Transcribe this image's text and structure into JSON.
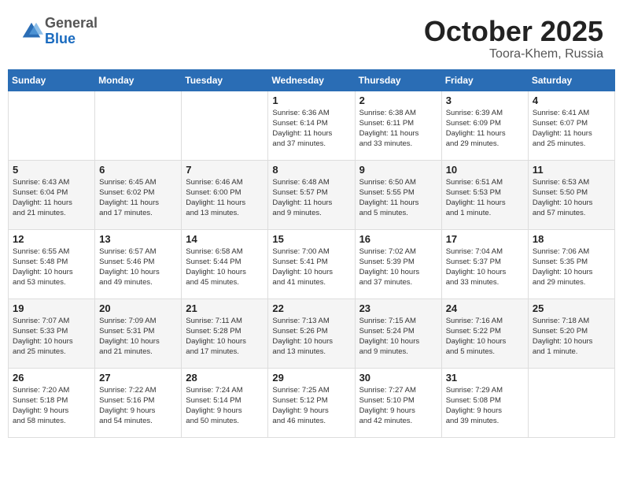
{
  "header": {
    "logo_general": "General",
    "logo_blue": "Blue",
    "month": "October 2025",
    "location": "Toora-Khem, Russia"
  },
  "days_of_week": [
    "Sunday",
    "Monday",
    "Tuesday",
    "Wednesday",
    "Thursday",
    "Friday",
    "Saturday"
  ],
  "weeks": [
    [
      {
        "day": "",
        "info": ""
      },
      {
        "day": "",
        "info": ""
      },
      {
        "day": "",
        "info": ""
      },
      {
        "day": "1",
        "info": "Sunrise: 6:36 AM\nSunset: 6:14 PM\nDaylight: 11 hours\nand 37 minutes."
      },
      {
        "day": "2",
        "info": "Sunrise: 6:38 AM\nSunset: 6:11 PM\nDaylight: 11 hours\nand 33 minutes."
      },
      {
        "day": "3",
        "info": "Sunrise: 6:39 AM\nSunset: 6:09 PM\nDaylight: 11 hours\nand 29 minutes."
      },
      {
        "day": "4",
        "info": "Sunrise: 6:41 AM\nSunset: 6:07 PM\nDaylight: 11 hours\nand 25 minutes."
      }
    ],
    [
      {
        "day": "5",
        "info": "Sunrise: 6:43 AM\nSunset: 6:04 PM\nDaylight: 11 hours\nand 21 minutes."
      },
      {
        "day": "6",
        "info": "Sunrise: 6:45 AM\nSunset: 6:02 PM\nDaylight: 11 hours\nand 17 minutes."
      },
      {
        "day": "7",
        "info": "Sunrise: 6:46 AM\nSunset: 6:00 PM\nDaylight: 11 hours\nand 13 minutes."
      },
      {
        "day": "8",
        "info": "Sunrise: 6:48 AM\nSunset: 5:57 PM\nDaylight: 11 hours\nand 9 minutes."
      },
      {
        "day": "9",
        "info": "Sunrise: 6:50 AM\nSunset: 5:55 PM\nDaylight: 11 hours\nand 5 minutes."
      },
      {
        "day": "10",
        "info": "Sunrise: 6:51 AM\nSunset: 5:53 PM\nDaylight: 11 hours\nand 1 minute."
      },
      {
        "day": "11",
        "info": "Sunrise: 6:53 AM\nSunset: 5:50 PM\nDaylight: 10 hours\nand 57 minutes."
      }
    ],
    [
      {
        "day": "12",
        "info": "Sunrise: 6:55 AM\nSunset: 5:48 PM\nDaylight: 10 hours\nand 53 minutes."
      },
      {
        "day": "13",
        "info": "Sunrise: 6:57 AM\nSunset: 5:46 PM\nDaylight: 10 hours\nand 49 minutes."
      },
      {
        "day": "14",
        "info": "Sunrise: 6:58 AM\nSunset: 5:44 PM\nDaylight: 10 hours\nand 45 minutes."
      },
      {
        "day": "15",
        "info": "Sunrise: 7:00 AM\nSunset: 5:41 PM\nDaylight: 10 hours\nand 41 minutes."
      },
      {
        "day": "16",
        "info": "Sunrise: 7:02 AM\nSunset: 5:39 PM\nDaylight: 10 hours\nand 37 minutes."
      },
      {
        "day": "17",
        "info": "Sunrise: 7:04 AM\nSunset: 5:37 PM\nDaylight: 10 hours\nand 33 minutes."
      },
      {
        "day": "18",
        "info": "Sunrise: 7:06 AM\nSunset: 5:35 PM\nDaylight: 10 hours\nand 29 minutes."
      }
    ],
    [
      {
        "day": "19",
        "info": "Sunrise: 7:07 AM\nSunset: 5:33 PM\nDaylight: 10 hours\nand 25 minutes."
      },
      {
        "day": "20",
        "info": "Sunrise: 7:09 AM\nSunset: 5:31 PM\nDaylight: 10 hours\nand 21 minutes."
      },
      {
        "day": "21",
        "info": "Sunrise: 7:11 AM\nSunset: 5:28 PM\nDaylight: 10 hours\nand 17 minutes."
      },
      {
        "day": "22",
        "info": "Sunrise: 7:13 AM\nSunset: 5:26 PM\nDaylight: 10 hours\nand 13 minutes."
      },
      {
        "day": "23",
        "info": "Sunrise: 7:15 AM\nSunset: 5:24 PM\nDaylight: 10 hours\nand 9 minutes."
      },
      {
        "day": "24",
        "info": "Sunrise: 7:16 AM\nSunset: 5:22 PM\nDaylight: 10 hours\nand 5 minutes."
      },
      {
        "day": "25",
        "info": "Sunrise: 7:18 AM\nSunset: 5:20 PM\nDaylight: 10 hours\nand 1 minute."
      }
    ],
    [
      {
        "day": "26",
        "info": "Sunrise: 7:20 AM\nSunset: 5:18 PM\nDaylight: 9 hours\nand 58 minutes."
      },
      {
        "day": "27",
        "info": "Sunrise: 7:22 AM\nSunset: 5:16 PM\nDaylight: 9 hours\nand 54 minutes."
      },
      {
        "day": "28",
        "info": "Sunrise: 7:24 AM\nSunset: 5:14 PM\nDaylight: 9 hours\nand 50 minutes."
      },
      {
        "day": "29",
        "info": "Sunrise: 7:25 AM\nSunset: 5:12 PM\nDaylight: 9 hours\nand 46 minutes."
      },
      {
        "day": "30",
        "info": "Sunrise: 7:27 AM\nSunset: 5:10 PM\nDaylight: 9 hours\nand 42 minutes."
      },
      {
        "day": "31",
        "info": "Sunrise: 7:29 AM\nSunset: 5:08 PM\nDaylight: 9 hours\nand 39 minutes."
      },
      {
        "day": "",
        "info": ""
      }
    ]
  ]
}
